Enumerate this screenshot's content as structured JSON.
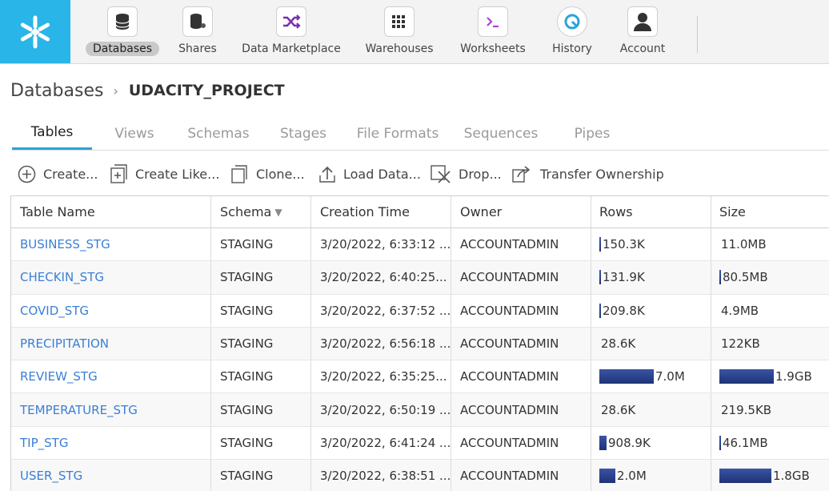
{
  "nav": {
    "items": [
      {
        "label": "Databases",
        "icon": "database-icon",
        "active": true
      },
      {
        "label": "Shares",
        "icon": "share-icon"
      },
      {
        "label": "Data Marketplace",
        "icon": "shuffle-icon"
      },
      {
        "label": "Warehouses",
        "icon": "grid-icon"
      },
      {
        "label": "Worksheets",
        "icon": "terminal-icon"
      },
      {
        "label": "History",
        "icon": "history-icon"
      },
      {
        "label": "Account",
        "icon": "user-icon"
      }
    ]
  },
  "breadcrumb": {
    "root": "Databases",
    "separator": "›",
    "current": "UDACITY_PROJECT"
  },
  "tabs": [
    {
      "label": "Tables",
      "active": true
    },
    {
      "label": "Views"
    },
    {
      "label": "Schemas"
    },
    {
      "label": "Stages"
    },
    {
      "label": "File Formats"
    },
    {
      "label": "Sequences"
    },
    {
      "label": "Pipes"
    }
  ],
  "toolbar": {
    "create": "Create...",
    "create_like": "Create Like...",
    "clone": "Clone...",
    "load_data": "Load Data...",
    "drop": "Drop...",
    "transfer": "Transfer Ownership"
  },
  "table": {
    "headers": {
      "name": "Table Name",
      "schema": "Schema",
      "created": "Creation Time",
      "owner": "Owner",
      "rows": "Rows",
      "size": "Size"
    },
    "sort_indicator": "▼",
    "rows": [
      {
        "name": "BUSINESS_STG",
        "schema": "STAGING",
        "created": "3/20/2022, 6:33:12 ...",
        "owner": "ACCOUNTADMIN",
        "rows": "150.3K",
        "rows_frac": 0.02,
        "size": "11.0MB",
        "size_frac": 0.0
      },
      {
        "name": "CHECKIN_STG",
        "schema": "STAGING",
        "created": "3/20/2022, 6:40:25...",
        "owner": "ACCOUNTADMIN",
        "rows": "131.9K",
        "rows_frac": 0.02,
        "size": "80.5MB",
        "size_frac": 0.04
      },
      {
        "name": "COVID_STG",
        "schema": "STAGING",
        "created": "3/20/2022, 6:37:52 ...",
        "owner": "ACCOUNTADMIN",
        "rows": "209.8K",
        "rows_frac": 0.03,
        "size": "4.9MB",
        "size_frac": 0.0
      },
      {
        "name": "PRECIPITATION",
        "schema": "STAGING",
        "created": "3/20/2022, 6:56:18 ...",
        "owner": "ACCOUNTADMIN",
        "rows": "28.6K",
        "rows_frac": 0.0,
        "size": "122KB",
        "size_frac": 0.0
      },
      {
        "name": "REVIEW_STG",
        "schema": "STAGING",
        "created": "3/20/2022, 6:35:25...",
        "owner": "ACCOUNTADMIN",
        "rows": "7.0M",
        "rows_frac": 1.0,
        "size": "1.9GB",
        "size_frac": 1.0
      },
      {
        "name": "TEMPERATURE_STG",
        "schema": "STAGING",
        "created": "3/20/2022, 6:50:19 ...",
        "owner": "ACCOUNTADMIN",
        "rows": "28.6K",
        "rows_frac": 0.0,
        "size": "219.5KB",
        "size_frac": 0.0
      },
      {
        "name": "TIP_STG",
        "schema": "STAGING",
        "created": "3/20/2022, 6:41:24 ...",
        "owner": "ACCOUNTADMIN",
        "rows": "908.9K",
        "rows_frac": 0.13,
        "size": "46.1MB",
        "size_frac": 0.02
      },
      {
        "name": "USER_STG",
        "schema": "STAGING",
        "created": "3/20/2022, 6:38:51 ...",
        "owner": "ACCOUNTADMIN",
        "rows": "2.0M",
        "rows_frac": 0.29,
        "size": "1.8GB",
        "size_frac": 0.95
      }
    ]
  }
}
